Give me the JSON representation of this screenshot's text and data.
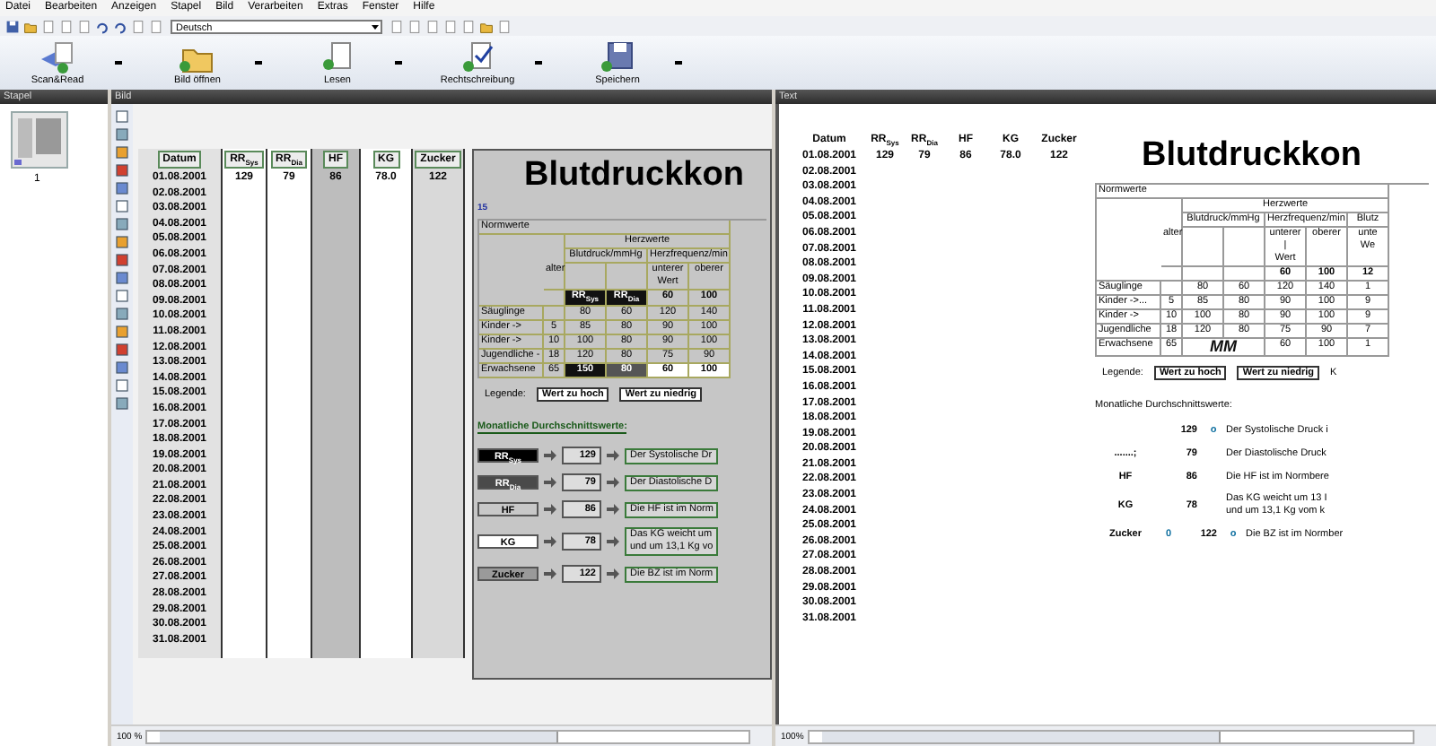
{
  "menu": [
    "Datei",
    "Bearbeiten",
    "Anzeigen",
    "Stapel",
    "Bild",
    "Verarbeiten",
    "Extras",
    "Fenster",
    "Hilfe"
  ],
  "language": "Deutsch",
  "actions": [
    {
      "kind": "scan",
      "label": "Scan&Read"
    },
    {
      "kind": "open",
      "label": "Bild öffnen"
    },
    {
      "kind": "read",
      "label": "Lesen"
    },
    {
      "kind": "spell",
      "label": "Rechtschreibung"
    },
    {
      "kind": "save",
      "label": "Speichern"
    }
  ],
  "panels": {
    "stapel": {
      "title": "Stapel",
      "page_number": "1"
    },
    "bild": {
      "title": "Bild",
      "zoom": "100 %",
      "doc": {
        "kind": "scan",
        "headers": [
          "Datum",
          "RR$_{Sys}$",
          "RR$_{Dia}$",
          "HF",
          "KG",
          "Zucker"
        ],
        "first_row": [
          "01.08.2001",
          "129",
          "79",
          "86",
          "78.0",
          "122"
        ],
        "dates": [
          "02.08.2001",
          "03.08.2001",
          "04.08.2001",
          "05.08.2001",
          "06.08.2001",
          "07.08.2001",
          "08.08.2001",
          "09.08.2001",
          "10.08.2001",
          "11.08.2001",
          "12.08.2001",
          "13.08.2001",
          "14.08.2001",
          "15.08.2001",
          "16.08.2001",
          "17.08.2001",
          "18.08.2001",
          "19.08.2001",
          "20.08.2001",
          "21.08.2001",
          "22.08.2001",
          "23.08.2001",
          "24.08.2001",
          "25.08.2001",
          "26.08.2001",
          "27.08.2001",
          "28.08.2001",
          "29.08.2001",
          "30.08.2001",
          "31.08.2001"
        ],
        "title": "Blutdruckkon",
        "sheet_label": "15",
        "norm": {
          "title": "Normwerte",
          "group": "Herzwerte",
          "age": "alter",
          "groups": [
            {
              "title": "Blutdruck/mmHg",
              "columns": [
                {
                  "mark": "RR$_{Sys}$"
                },
                {
                  "mark": "RR$_{Dia}$"
                }
              ]
            },
            {
              "title": "Herzfrequenz/min",
              "columns": [
                {
                  "head": "unterer\nWert",
                  "mark": "60"
                },
                {
                  "head": "oberer",
                  "mark": "100"
                }
              ]
            }
          ],
          "rows": [
            {
              "name": "Säuglinge",
              "values": [
                "80",
                "60",
                "120",
                "140"
              ],
              "alert": false
            },
            {
              "name": "Kinder ->",
              "age": "5",
              "values": [
                "85",
                "80",
                "90",
                "100"
              ],
              "alert": false
            },
            {
              "name": "Kinder ->",
              "age": "10",
              "values": [
                "100",
                "80",
                "90",
                "100"
              ],
              "alert": false
            },
            {
              "name": "Jugendliche -",
              "age": "18",
              "values": [
                "120",
                "80",
                "75",
                "90"
              ],
              "alert": false
            },
            {
              "name": "Erwachsene",
              "age": "65",
              "values": [
                "150",
                "80",
                "60",
                "100"
              ],
              "alert": true
            }
          ]
        },
        "legend": [
          "Legende:",
          "Wert zu hoch",
          "Wert zu niedrig"
        ],
        "averages": {
          "title": "Monatliche Durchschnittswerte:",
          "rows": [
            {
              "label": "RR$_{Sys}$",
              "color": "#000000",
              "value": "129",
              "text": [
                "Der Systolische Dr"
              ]
            },
            {
              "label": "RR$_{Dia}$",
              "color": "#4a4a4a",
              "value": "79",
              "text": [
                "Der Diastolische D"
              ]
            },
            {
              "label": "HF",
              "color": "#c8c8c8",
              "value": "86",
              "text": [
                "Die HF ist im Norm"
              ]
            },
            {
              "label": "KG",
              "color": "#ffffff",
              "value": "78",
              "text": [
                "Das KG weicht um",
                "und um 13,1 Kg vo"
              ]
            },
            {
              "label": "Zucker",
              "color": "#9a9a9a",
              "value": "122",
              "text": [
                "Die BZ ist im Norm"
              ]
            }
          ]
        }
      }
    },
    "text": {
      "title": "Text",
      "zoom": "100%",
      "doc": {
        "kind": "text",
        "headers": [
          "Datum",
          "RR$_{Sys}$",
          "RR$_{Dia}$",
          "HF",
          "KG",
          "Zucker"
        ],
        "first_row": [
          "01.08.2001",
          "129",
          "79",
          "86",
          "78.0",
          "122"
        ],
        "dates": [
          "02.08.2001",
          "03.08.2001",
          "04.08.2001",
          "05.08.2001",
          "06.08.2001",
          "07.08.2001",
          "08.08.2001",
          "09.08.2001",
          "10.08.2001",
          "11.08.2001",
          "12.08.2001",
          "13.08.2001",
          "14.08.2001",
          "15.08.2001",
          "16.08.2001",
          "17.08.2001",
          "18.08.2001",
          "19.08.2001",
          "20.08.2001",
          "21.08.2001",
          "22.08.2001",
          "23.08.2001",
          "24.08.2001",
          "25.08.2001",
          "26.08.2001",
          "27.08.2001",
          "28.08.2001",
          "29.08.2001",
          "30.08.2001",
          "31.08.2001"
        ],
        "title": "Blutdruckkon",
        "norm": {
          "title": "Normwerte",
          "group": "Herzwerte",
          "age": "alter",
          "groups": [
            {
              "title": "Blutdruck/mmHg",
              "columns": [
                {},
                {}
              ]
            },
            {
              "title": "Herzfrequenz/min",
              "columns": [
                {
                  "head": "unterer |\nWert",
                  "mark": "60"
                },
                {
                  "head": "oberer",
                  "mark": "100"
                }
              ]
            },
            {
              "title": "Blutz",
              "columns": [
                {
                  "head": "unte\nWe",
                  "mark": "12"
                }
              ]
            }
          ],
          "rows": [
            {
              "name": "Säuglinge",
              "values": [
                "80",
                "60",
                "120",
                "140",
                "1"
              ],
              "alert": false
            },
            {
              "name": "Kinder ->...",
              "age": "5",
              "values": [
                "85",
                "80",
                "90",
                "100",
                "9"
              ],
              "alert": false
            },
            {
              "name": "Kinder ->",
              "age": "10",
              "values": [
                "100",
                "80",
                "90",
                "100",
                "9"
              ],
              "alert": false
            },
            {
              "name": "Jugendliche",
              "age": "18",
              "values": [
                "120",
                "80",
                "75",
                "90",
                "7"
              ],
              "alert": false
            },
            {
              "name": "Erwachsene",
              "age": "65",
              "values": [
                "MM",
                "60",
                "100",
                "1"
              ],
              "alert": false,
              "merged": true
            }
          ]
        },
        "legend": [
          "Legende:",
          "Wert zu hoch",
          "Wert zu niedrig",
          "K"
        ],
        "averages": {
          "title": "Monatliche Durchschnittswerte:",
          "rows": [
            {
              "value": "129",
              "marker": "o",
              "text": [
                "Der Systolische Druck i"
              ]
            },
            {
              "label": ".......;",
              "value": "79",
              "text": [
                "Der Diastolische Druck"
              ]
            },
            {
              "label": "HF",
              "value": "86",
              "text": [
                "Die HF ist im Normbere"
              ]
            },
            {
              "label": "KG",
              "value": "78",
              "text": [
                "Das KG weicht um 13 I",
                "und um 13,1 Kg vom k"
              ]
            },
            {
              "label": "Zucker",
              "pre": "0",
              "value": "122",
              "marker": "o",
              "text": [
                "Die BZ ist im Normber"
              ]
            }
          ]
        }
      }
    }
  }
}
